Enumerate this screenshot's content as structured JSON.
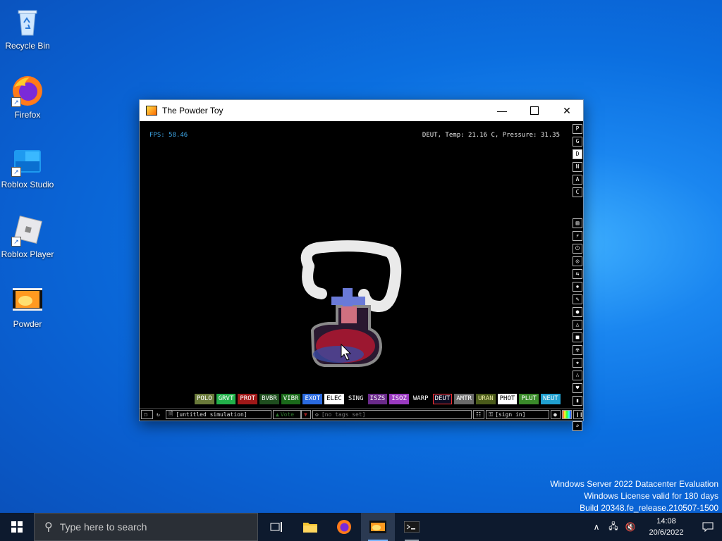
{
  "desktop": {
    "icons": [
      {
        "label": "Recycle Bin"
      },
      {
        "label": "Firefox"
      },
      {
        "label": "Roblox Studio"
      },
      {
        "label": "Roblox Player"
      },
      {
        "label": "Powder"
      }
    ],
    "watermark": {
      "line1": "Windows Server 2022 Datacenter Evaluation",
      "line2": "Windows License valid for 180 days",
      "line3": "Build 20348.fe_release.210507-1500"
    }
  },
  "window": {
    "title": "The Powder Toy",
    "fps": "FPS: 58.46",
    "hud": "DEUT, Temp: 21.16 C, Pressure: 31.35",
    "top_buttons": [
      "P",
      "G",
      "D",
      "N",
      "A",
      "C"
    ],
    "active_top_button": "D",
    "side_tools": [
      "wall-icon",
      "electronics-icon",
      "power-icon",
      "sensor-icon",
      "force-icon",
      "explosive-icon",
      "pencil-icon",
      "liquid-icon",
      "gas-icon",
      "solid-icon",
      "radioactive-icon",
      "special-icon",
      "particles-icon",
      "life-icon",
      "tools-icon",
      "favorite-icon",
      "search-tool-icon"
    ],
    "elements": [
      {
        "label": "POLO",
        "bg": "#6a7a3a",
        "fg": "#ffffff"
      },
      {
        "label": "GRVT",
        "bg": "#22b04a",
        "fg": "#ffffff"
      },
      {
        "label": "PROT",
        "bg": "#a01818",
        "fg": "#ffffff"
      },
      {
        "label": "BVBR",
        "bg": "#1e4d1e",
        "fg": "#ffffff"
      },
      {
        "label": "VIBR",
        "bg": "#1a6a1a",
        "fg": "#ffffff"
      },
      {
        "label": "EXOT",
        "bg": "#2a6ae0",
        "fg": "#ffffff"
      },
      {
        "label": "ELEC",
        "bg": "#ffffff",
        "fg": "#000000"
      },
      {
        "label": "SING",
        "bg": "#000000",
        "fg": "#ffffff"
      },
      {
        "label": "ISZS",
        "bg": "#6a2a8a",
        "fg": "#ffffff"
      },
      {
        "label": "ISOZ",
        "bg": "#9a3ac0",
        "fg": "#ffffff"
      },
      {
        "label": "WARP",
        "bg": "#000000",
        "fg": "#ffffff"
      },
      {
        "label": "DEUT",
        "bg": "#0a0a20",
        "fg": "#ffffff",
        "selected": true
      },
      {
        "label": "AMTR",
        "bg": "#6a6a6a",
        "fg": "#ffffff"
      },
      {
        "label": "URAN",
        "bg": "#4a5a1a",
        "fg": "#e8e8a0"
      },
      {
        "label": "PHOT",
        "bg": "#ffffff",
        "fg": "#000000"
      },
      {
        "label": "PLUT",
        "bg": "#3a8a2a",
        "fg": "#ffffff"
      },
      {
        "label": "NEUT",
        "bg": "#20a0d0",
        "fg": "#ffffff"
      }
    ],
    "status": {
      "save_name": "[untitled simulation]",
      "vote_label": "Vote",
      "tags": "[no tags set]",
      "sign_in": "[sign in]"
    }
  },
  "taskbar": {
    "search_placeholder": "Type here to search",
    "time": "14:08",
    "date": "20/6/2022"
  }
}
